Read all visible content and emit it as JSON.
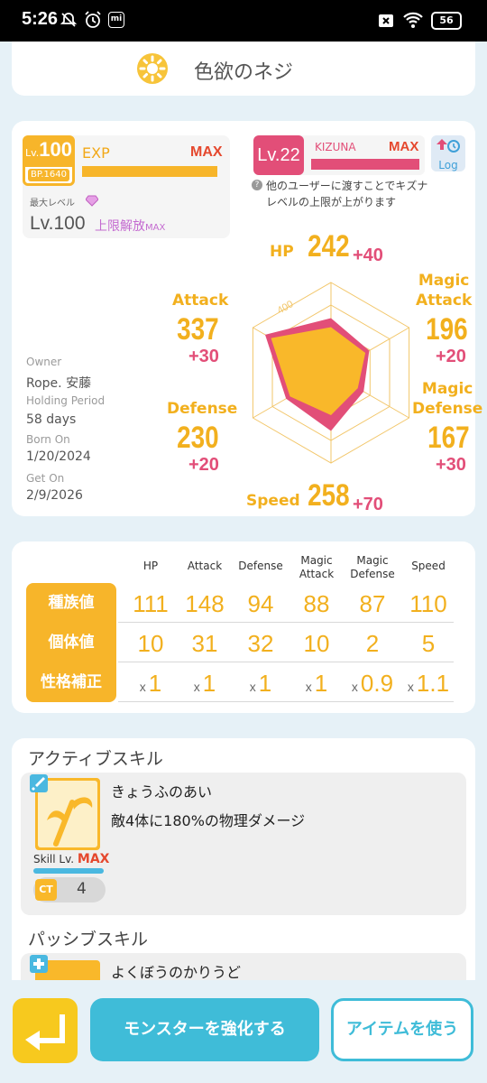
{
  "status": {
    "time": "5:26",
    "battery": "56"
  },
  "header": {
    "title": "色欲のネジ"
  },
  "level_panel": {
    "level_prefix": "Lv.",
    "level": "100",
    "bp": "BP.1640",
    "exp_label": "EXP",
    "exp_value": "MAX",
    "exp_progress": 1.0,
    "max_level_label": "最大レベル",
    "max_level": "Lv.100",
    "limit_break": "上限解放",
    "limit_break_max": "MAX"
  },
  "kizuna_panel": {
    "level": "Lv.22",
    "label": "KIZUNA",
    "value": "MAX",
    "progress": 1.0,
    "log_label": "Log",
    "note_line1": "他のユーザーに渡すことでキズナ",
    "note_line2": "レベルの上限が上がります"
  },
  "owner_info": {
    "owner_label": "Owner",
    "owner": "Rope. 安藤",
    "holding_label": "Holding Period",
    "holding": "58 days",
    "born_label": "Born On",
    "born": "1/20/2024",
    "get_label": "Get On",
    "get": "2/9/2026"
  },
  "stats": {
    "hp": {
      "label": "HP",
      "value": "242",
      "bonus": "+40"
    },
    "attack": {
      "label": "Attack",
      "value": "337",
      "bonus": "+30"
    },
    "magic_attack": {
      "label1": "Magic",
      "label2": "Attack",
      "value": "196",
      "bonus": "+20"
    },
    "defense": {
      "label": "Defense",
      "value": "230",
      "bonus": "+20"
    },
    "magic_defense": {
      "label1": "Magic",
      "label2": "Defense",
      "value": "167",
      "bonus": "+30"
    },
    "speed": {
      "label": "Speed",
      "value": "258",
      "bonus": "+70"
    },
    "radar_scale_label": "400",
    "radar_scale_max": 400
  },
  "table": {
    "headers": [
      "HP",
      "Attack",
      "Defense",
      "Magic\nAttack",
      "Magic\nDefense",
      "Speed"
    ],
    "rows": [
      {
        "label": "種族値",
        "values": [
          "111",
          "148",
          "94",
          "88",
          "87",
          "110"
        ]
      },
      {
        "label": "個体値",
        "values": [
          "10",
          "31",
          "32",
          "10",
          "2",
          "5"
        ]
      },
      {
        "label": "性格補正",
        "values": [
          "1",
          "1",
          "1",
          "1",
          "0.9",
          "1.1"
        ],
        "prefix": "x"
      }
    ]
  },
  "active_skill": {
    "section_title": "アクティブスキル",
    "name": "きょうふのあい",
    "desc": "敵4体に180%の物理ダメージ",
    "skill_lv_label": "Skill Lv.",
    "skill_lv_value": "MAX",
    "ct_label": "CT",
    "ct_value": "4"
  },
  "passive_skill": {
    "section_title": "パッシブスキル",
    "name": "よくぼうのかりうど"
  },
  "bottom_bar": {
    "enhance_label": "モンスターを強化する",
    "use_item_label": "アイテムを使う"
  }
}
